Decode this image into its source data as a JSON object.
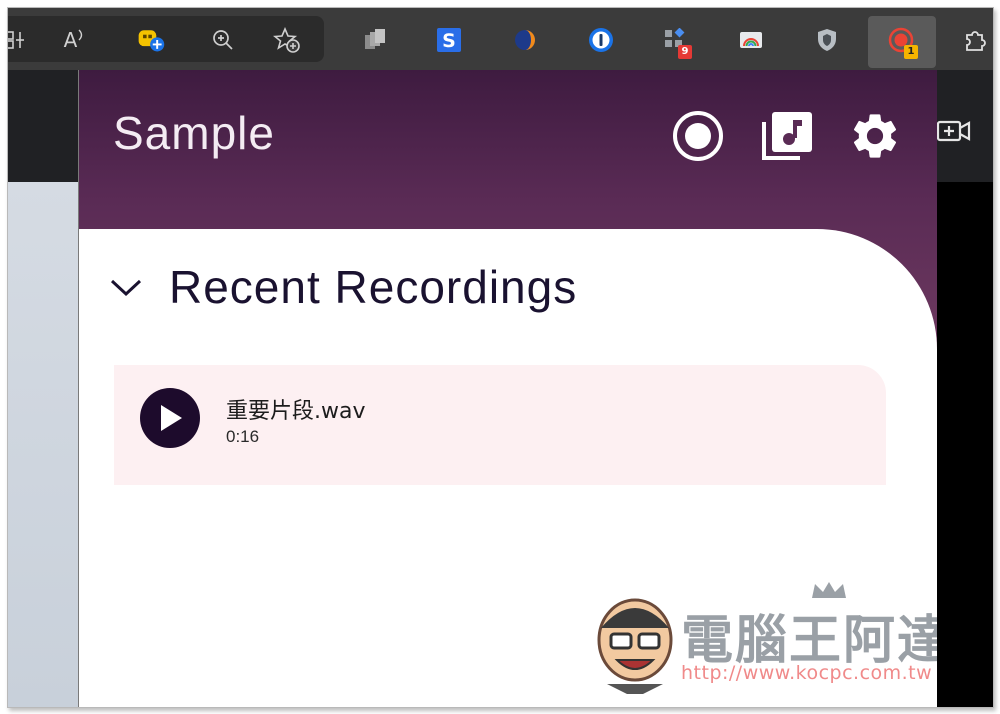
{
  "toolbar": {
    "read_aloud_glyph": "A",
    "extensions": [
      {
        "name": "sticky-ext",
        "color": "#f5c200"
      },
      {
        "name": "stacks-ext",
        "color": "#b9b9b9"
      },
      {
        "name": "s-ext",
        "letter": "S",
        "color": "#2a6ee8"
      },
      {
        "name": "orange-ext",
        "color": "#f08a1a"
      },
      {
        "name": "onepassword-ext",
        "color": "#1a73e8"
      },
      {
        "name": "apps-ext",
        "badge": "9",
        "color": "#e53935"
      },
      {
        "name": "rainbow-ext",
        "color": "#8ab4f8"
      },
      {
        "name": "shield-ext",
        "color": "#9aa0a6"
      },
      {
        "name": "recorder-ext",
        "badge": "1",
        "color": "#ea4335"
      }
    ]
  },
  "popup": {
    "title": "Sample",
    "header_buttons": [
      "record-icon",
      "library-music-icon",
      "settings-icon"
    ],
    "section_title": "Recent Recordings",
    "recordings": [
      {
        "name": "重要片段.wav",
        "duration": "0:16"
      }
    ]
  },
  "watermark": {
    "text": "電腦王阿達",
    "url": "http://www.kocpc.com.tw"
  },
  "colors": {
    "header_top": "#3e1b40",
    "header_bottom": "#6e3a60",
    "card_bg": "#fdf0f2",
    "play_bg": "#1d0b2c"
  }
}
